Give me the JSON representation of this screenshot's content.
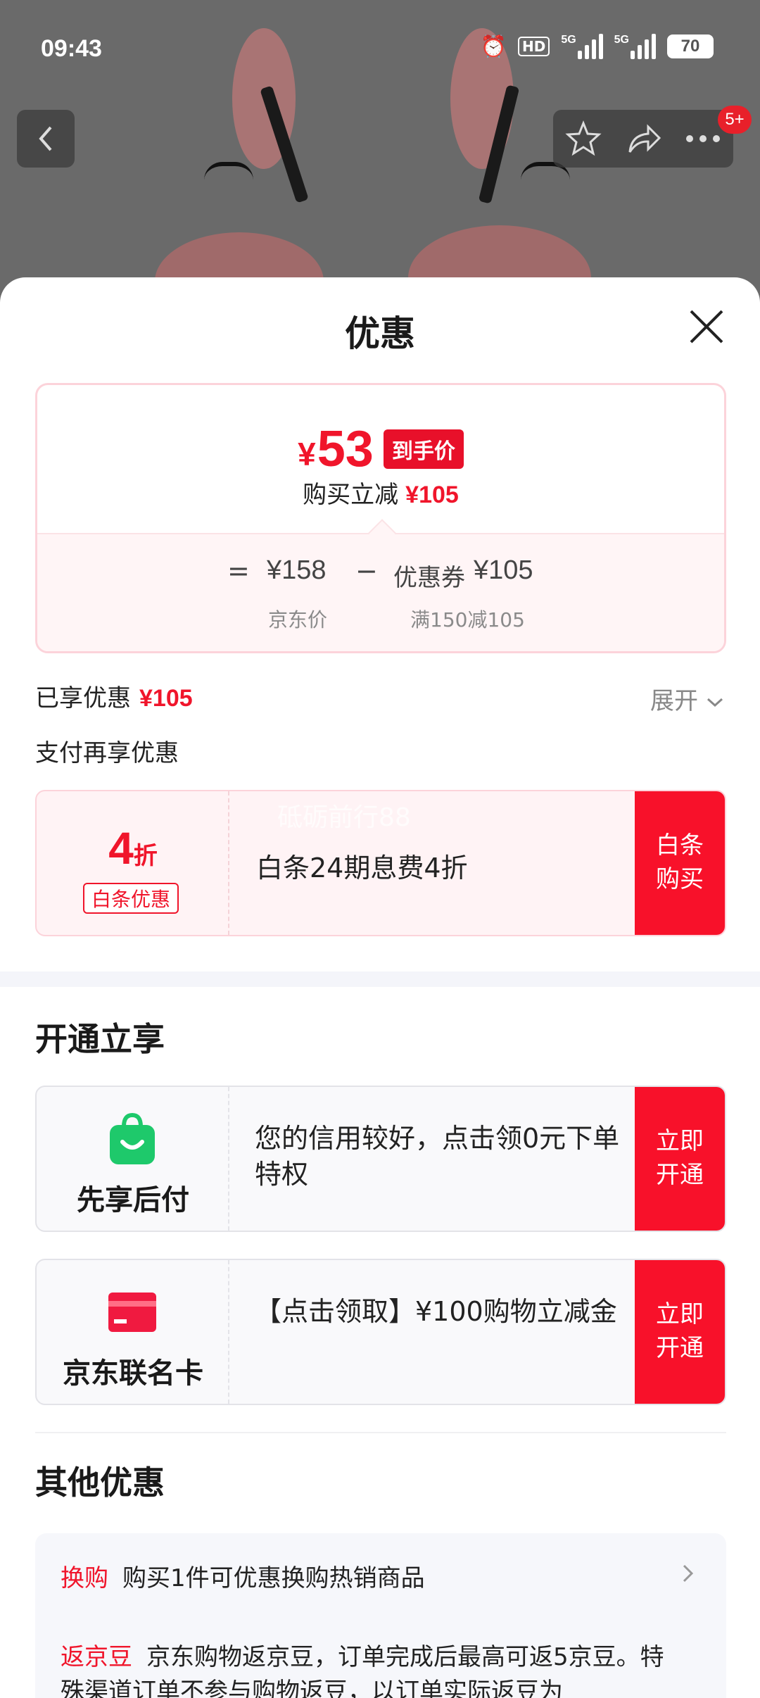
{
  "status_bar": {
    "time": "09:43",
    "hd": "HD",
    "net1": "5G",
    "net2": "5G",
    "battery": "70"
  },
  "nav": {
    "badge": "5+"
  },
  "sheet": {
    "title": "优惠"
  },
  "price_card": {
    "currency": "¥",
    "final_price": "53",
    "final_label": "到手价",
    "sub_label": "购买立减",
    "sub_value": "¥105",
    "eq": "=",
    "base_price": "¥158",
    "minus": "−",
    "coupon_label": "优惠券",
    "coupon_value": "¥105",
    "base_caption": "京东价",
    "coupon_caption": "满150减105"
  },
  "enjoyed": {
    "label": "已享优惠",
    "value": "¥105",
    "expand": "展开"
  },
  "pay_more": {
    "label": "支付再享优惠"
  },
  "baitiao": {
    "discount": "4",
    "discount_unit": "折",
    "tag": "白条优惠",
    "text": "白条24期息费4折",
    "cta_line1": "白条",
    "cta_line2": "购买",
    "watermark": "砥砺前行88"
  },
  "open_section": {
    "title": "开通立享",
    "cards": [
      {
        "label": "先享后付",
        "text": "您的信用较好，点击领0元下单特权",
        "cta_line1": "立即",
        "cta_line2": "开通"
      },
      {
        "label": "京东联名卡",
        "text": "【点击领取】¥100购物立减金",
        "cta_line1": "立即",
        "cta_line2": "开通"
      }
    ]
  },
  "other_section": {
    "title": "其他优惠",
    "items": [
      {
        "tag": "换购",
        "text": "购买1件可优惠换购热销商品"
      },
      {
        "tag": "返京豆",
        "text": "京东购物返京豆，订单完成后最高可返5京豆。特殊渠道订单不参与购物返豆，以订单实际返豆为"
      }
    ]
  },
  "colors": {
    "accent": "#f0152b",
    "cta": "#f8112a",
    "green": "#1ec96b"
  }
}
